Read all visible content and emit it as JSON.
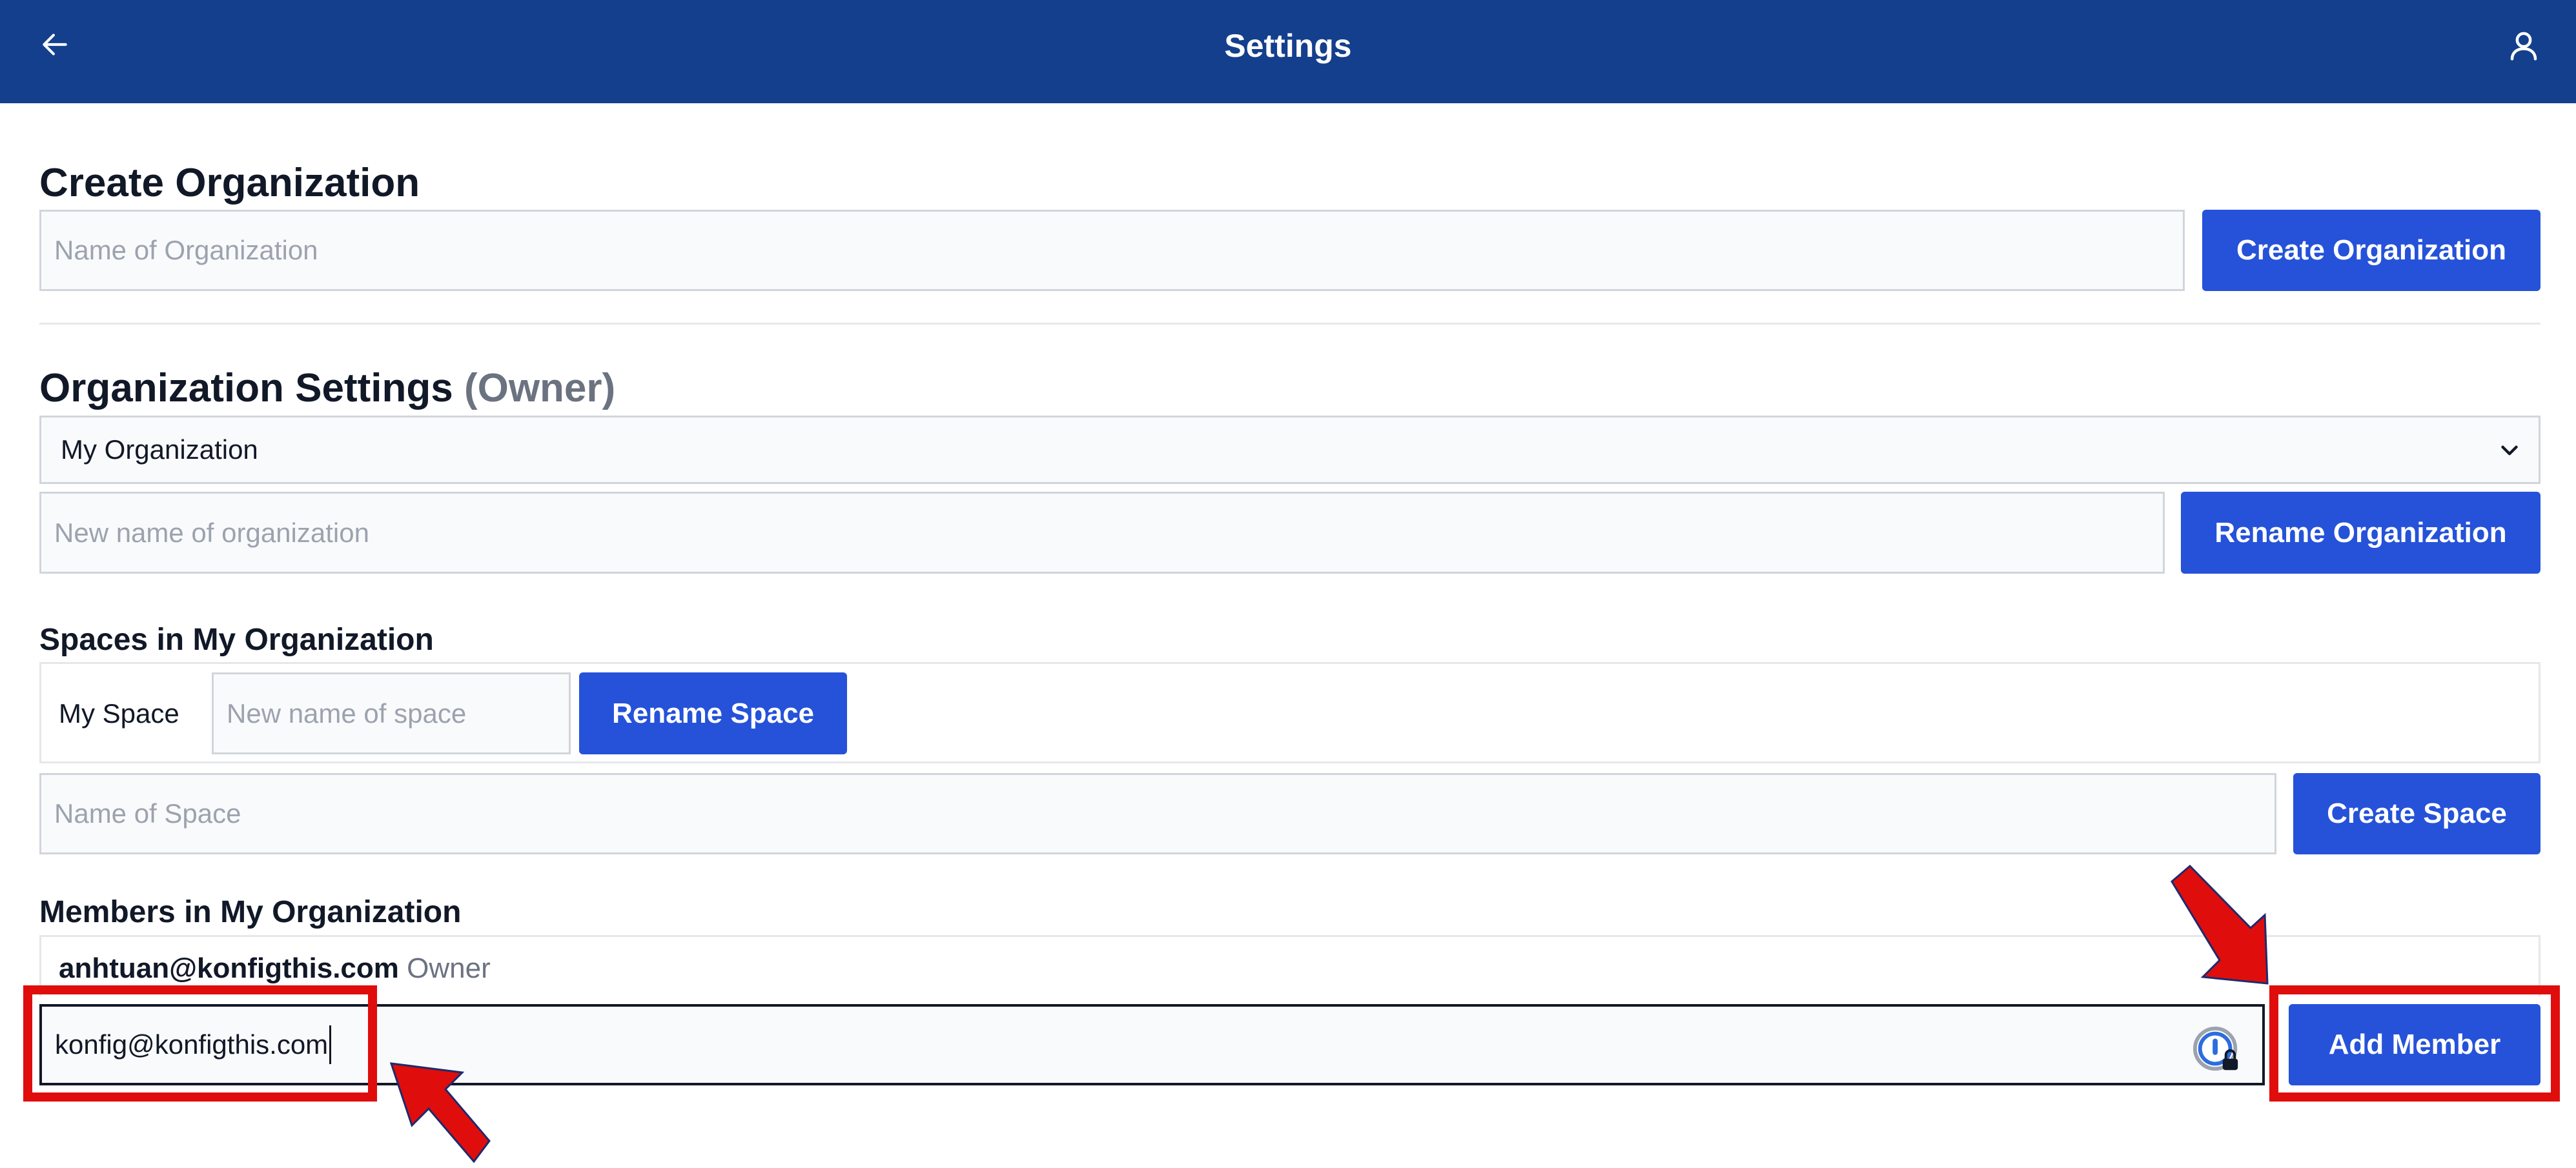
{
  "header": {
    "title": "Settings",
    "back_icon": "arrow-left-icon",
    "user_icon": "user-icon",
    "background_color": "#133f8d"
  },
  "create_org": {
    "heading": "Create Organization",
    "name_placeholder": "Name of Organization",
    "button_label": "Create Organization"
  },
  "org_settings": {
    "heading": "Organization Settings",
    "role": "(Owner)",
    "selected_org": "My Organization",
    "rename_placeholder": "New name of organization",
    "rename_button": "Rename Organization"
  },
  "spaces": {
    "heading": "Spaces in My Organization",
    "items": [
      {
        "name": "My Space",
        "rename_placeholder": "New name of space",
        "rename_button": "Rename Space"
      }
    ],
    "new_space_placeholder": "Name of Space",
    "create_button": "Create Space"
  },
  "members": {
    "heading": "Members in My Organization",
    "list": [
      {
        "email": "anhtuan@konfigthis.com",
        "role": "Owner"
      }
    ],
    "add_input_value": "konfig@konfigthis.com",
    "add_button": "Add Member",
    "password_manager_icon": "password-manager-lock-icon"
  },
  "annotations": {
    "highlight_color": "#e00d0d"
  },
  "accent_color": "#2552d9"
}
